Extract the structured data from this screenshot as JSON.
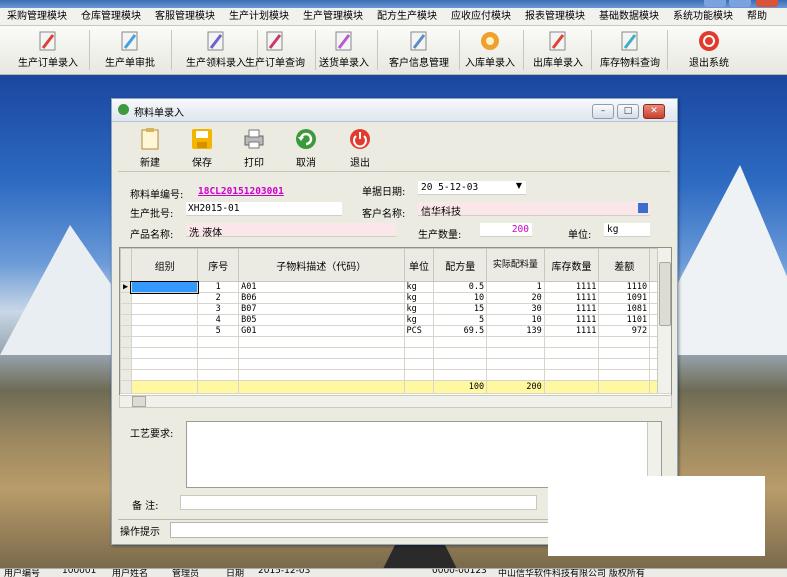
{
  "colors": {
    "accent": "#cc00cc",
    "pink_field": "#fbe7ea",
    "total_row": "#fff8a0",
    "selected_cell": "#3399ff"
  },
  "menu": [
    "采购管理模块",
    "仓库管理模块",
    "客服管理模块",
    "生产计划模块",
    "生产管理模块",
    "配方生产模块",
    "应收应付模块",
    "报表管理模块",
    "基础数据模块",
    "系统功能模块",
    "帮助"
  ],
  "toolbar": [
    {
      "label": "生产订单录入",
      "icon": "pdf-icon"
    },
    {
      "label": "生产单审批",
      "icon": "check-doc-icon"
    },
    {
      "label": "生产领料录入",
      "icon": "edit-doc-icon"
    },
    {
      "label": "生产订单查询",
      "icon": "query-doc-icon"
    },
    {
      "label": "送货单录入",
      "icon": "delivery-doc-icon"
    },
    {
      "label": "客户信息管理",
      "icon": "customer-doc-icon"
    },
    {
      "label": "入库单录入",
      "icon": "inbound-icon"
    },
    {
      "label": "出库单录入",
      "icon": "outbound-icon"
    },
    {
      "label": "库存物料查询",
      "icon": "search-doc-icon"
    },
    {
      "label": "退出系统",
      "icon": "exit-icon"
    }
  ],
  "dialog": {
    "title": "称料单录入",
    "buttons": {
      "new": "新建",
      "save": "保存",
      "print": "打印",
      "cancel": "取消",
      "exit": "退出"
    },
    "form": {
      "order_no_label": "称料单编号:",
      "order_no": "18CL20151203001",
      "date_label": "单据日期:",
      "date": "20 5-12-03",
      "batch_label": "生产批号:",
      "batch": "XH2015-01",
      "customer_label": "客户名称:",
      "customer": "信华科技",
      "product_label": "产品名称:",
      "product": "洗 液体",
      "qty_label": "生产数量:",
      "qty": "200",
      "unit_label": "单位:",
      "unit": "kg"
    },
    "table": {
      "headers": [
        "组别",
        "序号",
        "子物料描述（代码）",
        "单位",
        "配方量",
        "实际配料量",
        "库存数量",
        "差额"
      ],
      "rows": [
        {
          "group": "",
          "seq": "1",
          "code": "A01",
          "unit": "kg",
          "formula": "0.5",
          "actual": "1",
          "stock": "1111",
          "diff": "1110"
        },
        {
          "group": "",
          "seq": "2",
          "code": "B06",
          "unit": "kg",
          "formula": "10",
          "actual": "20",
          "stock": "1111",
          "diff": "1091"
        },
        {
          "group": "",
          "seq": "3",
          "code": "B07",
          "unit": "kg",
          "formula": "15",
          "actual": "30",
          "stock": "1111",
          "diff": "1081"
        },
        {
          "group": "",
          "seq": "4",
          "code": "B05",
          "unit": "kg",
          "formula": "5",
          "actual": "10",
          "stock": "1111",
          "diff": "1101"
        },
        {
          "group": "",
          "seq": "5",
          "code": "G01",
          "unit": "PCS",
          "formula": "69.5",
          "actual": "139",
          "stock": "1111",
          "diff": "972"
        }
      ],
      "totals": {
        "formula": "100",
        "actual": "200"
      }
    },
    "process_label": "工艺要求:",
    "remark_label": "备  注:",
    "hint_label": "操作提示"
  },
  "status": {
    "user_label": "用户编号",
    "user": "100001",
    "name_label": "用户姓名",
    "name": "管理员",
    "date_label": "日期",
    "date": "2015-12-03",
    "phone": "0000-00123",
    "company": "中山信华软件科技有限公司 版权所有"
  }
}
